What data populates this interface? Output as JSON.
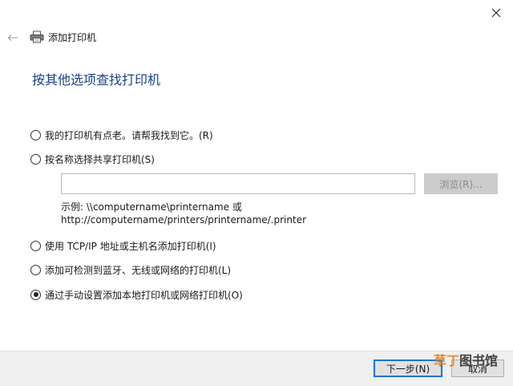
{
  "window": {
    "title": "添加打印机",
    "close_icon": "close-icon",
    "back_icon": "back-arrow-icon",
    "printer_icon": "printer-icon"
  },
  "heading": "按其他选项查找打印机",
  "options": [
    {
      "label": "我的打印机有点老。请帮我找到它。(R)",
      "checked": false
    },
    {
      "label": "按名称选择共享打印机(S)",
      "checked": false
    },
    {
      "label": "使用 TCP/IP 地址或主机名添加打印机(I)",
      "checked": false
    },
    {
      "label": "添加可检测到蓝牙、无线或网络的打印机(L)",
      "checked": false
    },
    {
      "label": "通过手动设置添加本地打印机或网络打印机(O)",
      "checked": true
    }
  ],
  "shared_printer": {
    "value": "",
    "browse_label": "浏览(R)...",
    "example_line1": "示例: \\\\computername\\printername 或",
    "example_line2": "http://computername/printers/printername/.printer"
  },
  "footer": {
    "next_label": "下一步(N)",
    "cancel_label": "取消"
  },
  "watermark": {
    "part1": "草丁",
    "part2": "图书馆"
  },
  "colors": {
    "heading": "#1e3f8a",
    "focus_border": "#0078d7",
    "footer_bg": "#f0f0f0"
  }
}
